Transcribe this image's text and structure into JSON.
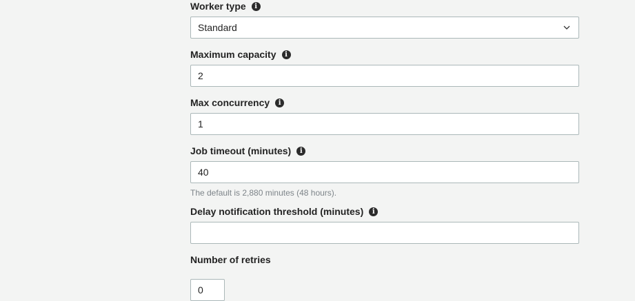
{
  "worker_type": {
    "label": "Worker type",
    "value": "Standard",
    "info_icon": "info-icon",
    "dropdown_icon": "chevron-down-icon"
  },
  "maximum_capacity": {
    "label": "Maximum capacity",
    "value": "2",
    "info_icon": "info-icon"
  },
  "max_concurrency": {
    "label": "Max concurrency",
    "value": "1",
    "info_icon": "info-icon"
  },
  "job_timeout": {
    "label": "Job timeout (minutes)",
    "value": "40",
    "hint": "The default is 2,880 minutes (48 hours).",
    "info_icon": "info-icon"
  },
  "delay_notification": {
    "label": "Delay notification threshold (minutes)",
    "value": "",
    "info_icon": "info-icon"
  },
  "number_of_retries": {
    "label": "Number of retries",
    "value": "0"
  },
  "colors": {
    "background": "#f3f4f3",
    "field_border": "#aab7b8",
    "label_text": "#232323",
    "hint_text": "#7d8489"
  }
}
